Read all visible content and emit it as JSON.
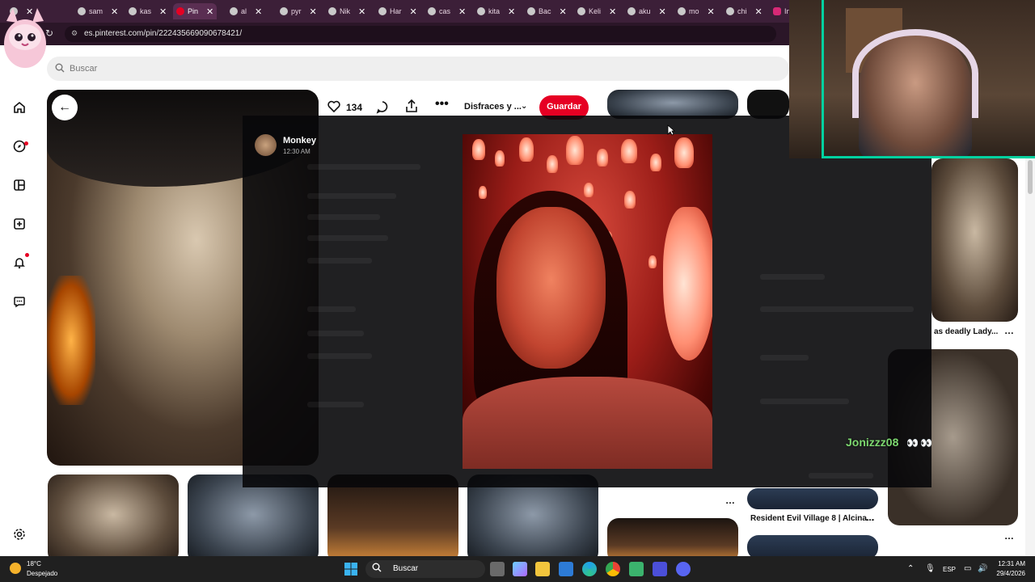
{
  "browser": {
    "tabs": [
      {
        "label": "sam",
        "favicon": "chrome-icon"
      },
      {
        "label": "kas",
        "favicon": "chrome-icon"
      },
      {
        "label": "Pin",
        "favicon": "pinterest-icon",
        "active": true
      },
      {
        "label": "al",
        "favicon": "chrome-icon"
      },
      {
        "label": "pyr",
        "favicon": "chrome-icon"
      },
      {
        "label": "Nik",
        "favicon": "chrome-icon"
      },
      {
        "label": "Har",
        "favicon": "chrome-icon"
      },
      {
        "label": "cas",
        "favicon": "chrome-icon"
      },
      {
        "label": "kita",
        "favicon": "chrome-icon"
      },
      {
        "label": "Bac",
        "favicon": "chrome-icon"
      },
      {
        "label": "Keli",
        "favicon": "chrome-icon"
      },
      {
        "label": "aku",
        "favicon": "chrome-icon"
      },
      {
        "label": "mo",
        "favicon": "chrome-icon"
      },
      {
        "label": "chi",
        "favicon": "chrome-icon"
      },
      {
        "label": "In",
        "favicon": "instagram-icon"
      }
    ],
    "url": "es.pinterest.com/pin/222435669090678421/"
  },
  "pinterest": {
    "search_placeholder": "Buscar",
    "pin": {
      "likes": "134",
      "board": "Disfraces y ...",
      "save_label": "Guardar"
    },
    "captions": {
      "right_top": "as deadly Lady...",
      "resident_evil": "Resident Evil Village 8 | Alcina..."
    }
  },
  "overlay": {
    "author": "Monkey",
    "time": "12:30 AM"
  },
  "stream": {
    "chat_user": "Jonizzz08",
    "chat_emotes": "👀👀"
  },
  "taskbar": {
    "weather_temp": "18°C",
    "weather_desc": "Despejado",
    "search_label": "Buscar",
    "lang": "ESP",
    "time": "12:31 AM",
    "date": "29/4/2026"
  },
  "colors": {
    "pinterest_red": "#e60023",
    "chat_name": "#7dd870",
    "webcam_border": "#00d1a0"
  }
}
